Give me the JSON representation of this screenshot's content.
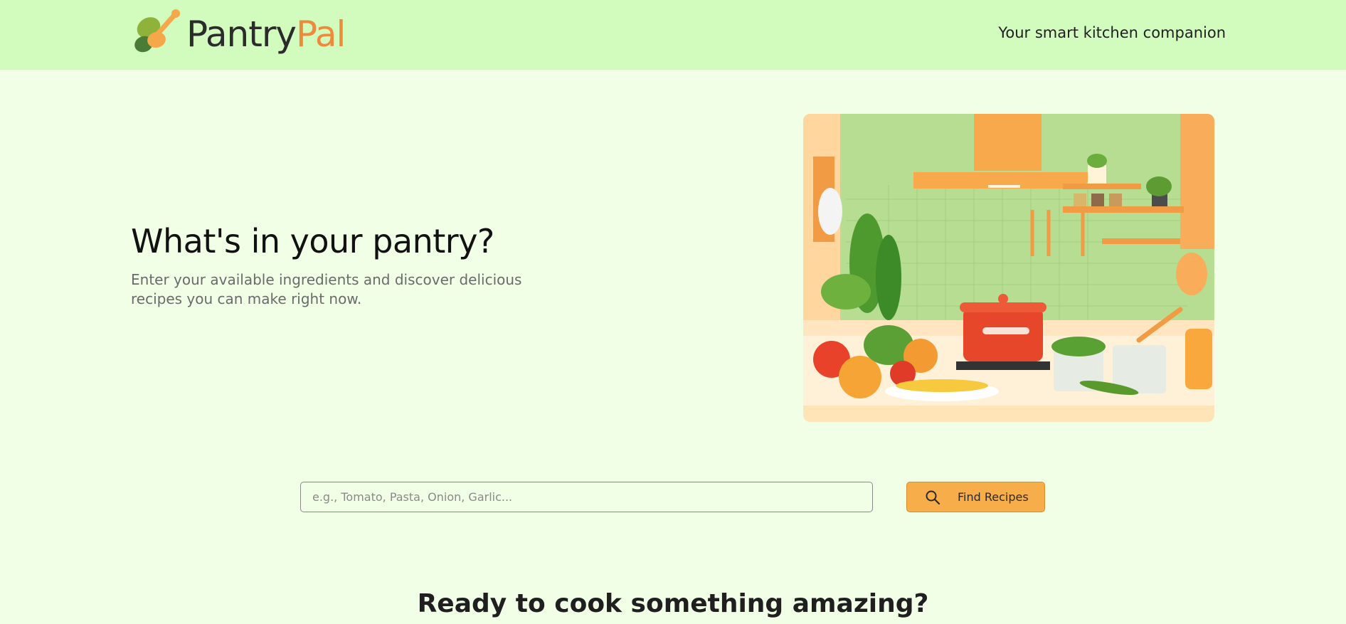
{
  "header": {
    "logo_part1": "Pantry",
    "logo_part2": "Pal",
    "tagline": "Your smart kitchen companion"
  },
  "hero": {
    "title": "What's in your pantry?",
    "subtitle": "Enter your available ingredients and discover delicious recipes you can make right now."
  },
  "search": {
    "placeholder": "e.g., Tomato, Pasta, Onion, Garlic...",
    "value": "",
    "button_label": "Find Recipes",
    "button_icon": "search-icon"
  },
  "section": {
    "heading": "Ready to cook something amazing?"
  },
  "colors": {
    "header_bg": "#d2fcbe",
    "page_bg": "#f0ffe6",
    "accent": "#ee8a3a",
    "button_bg": "#f7ad4a"
  }
}
